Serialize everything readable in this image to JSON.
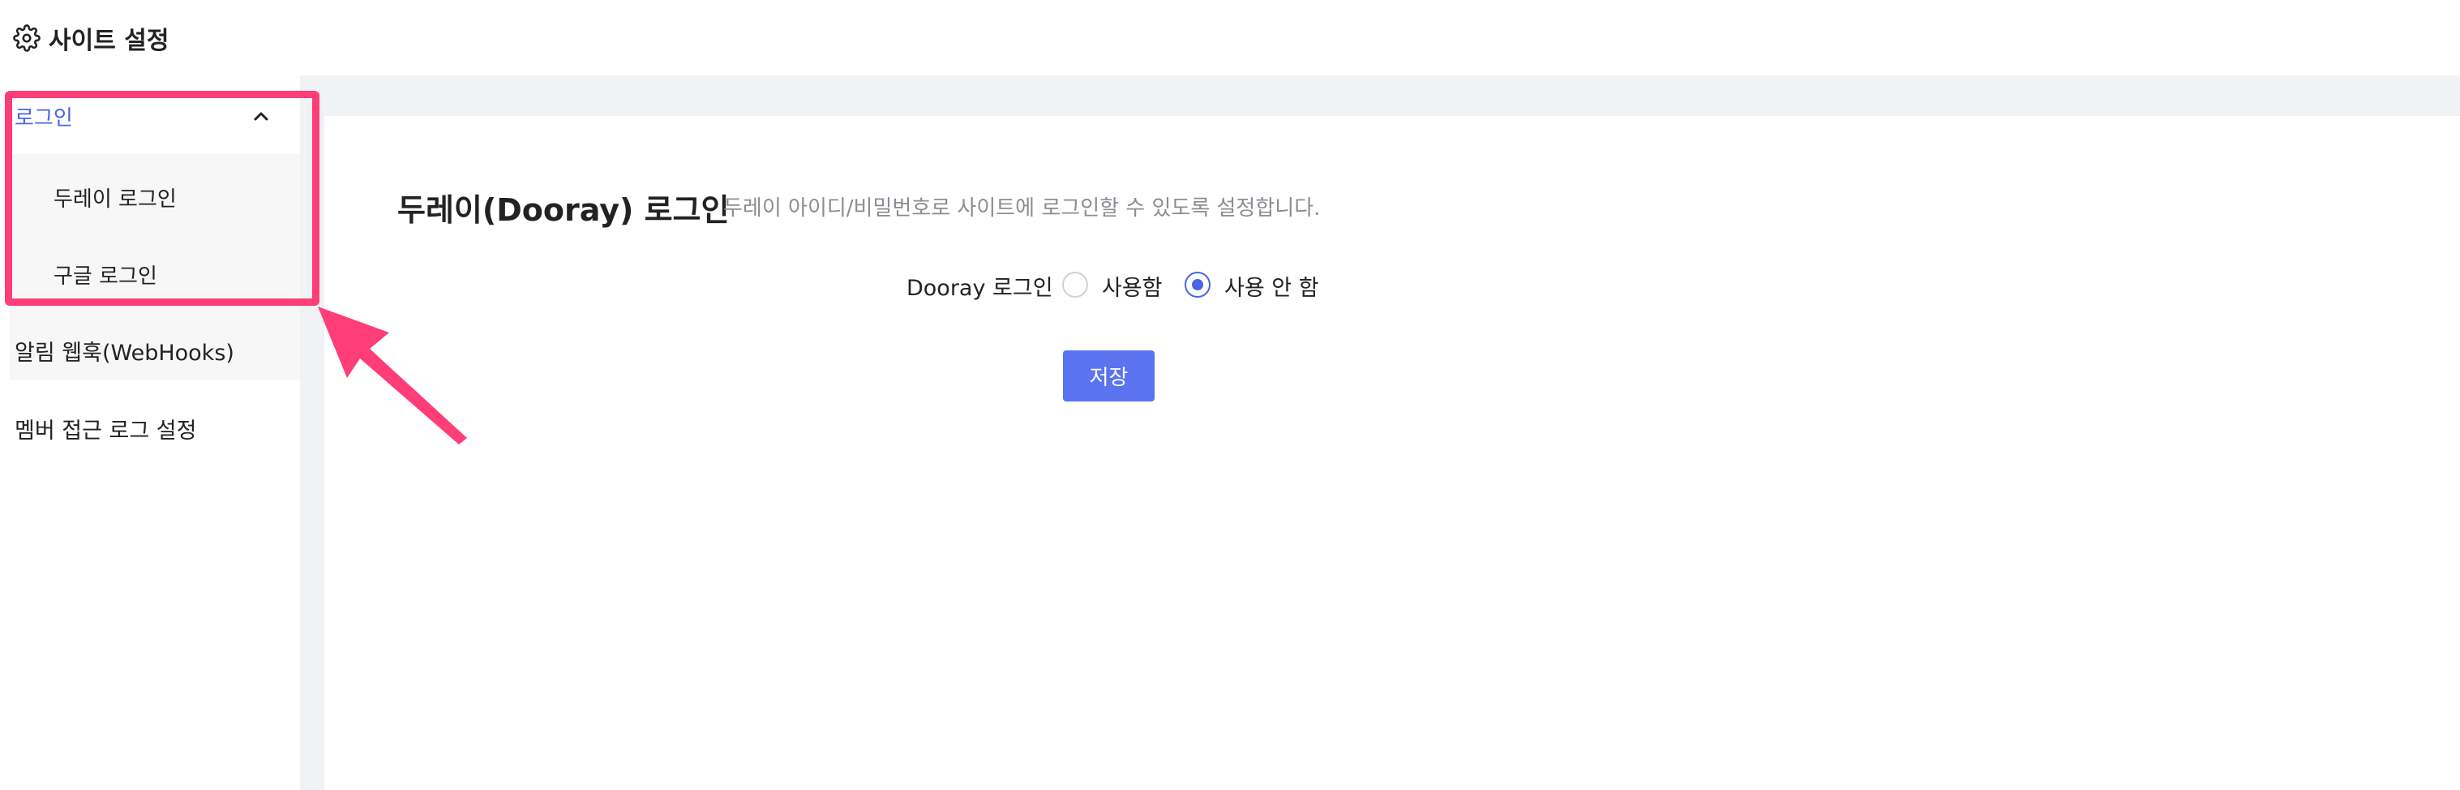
{
  "header": {
    "title": "사이트 설정",
    "icon": "gear-icon"
  },
  "sidebar": {
    "parent_label": "로그인",
    "sub_items": [
      "두레이 로그인",
      "구글 로그인"
    ],
    "items": [
      "알림 웹훅(WebHooks)",
      "멤버 접근 로그 설정"
    ]
  },
  "main": {
    "section_title": "두레이(Dooray) 로그인",
    "section_desc": "두레이 아이디/비밀번호로 사이트에 로그인할 수 있도록 설정합니다.",
    "field_label": "Dooray 로그인",
    "options": [
      "사용함",
      "사용 안 함"
    ],
    "selected_option": "사용 안 함",
    "save_label": "저장"
  },
  "colors": {
    "accent": "#4a64e6",
    "button": "#5b73ef",
    "annotation": "#ff3d77"
  }
}
